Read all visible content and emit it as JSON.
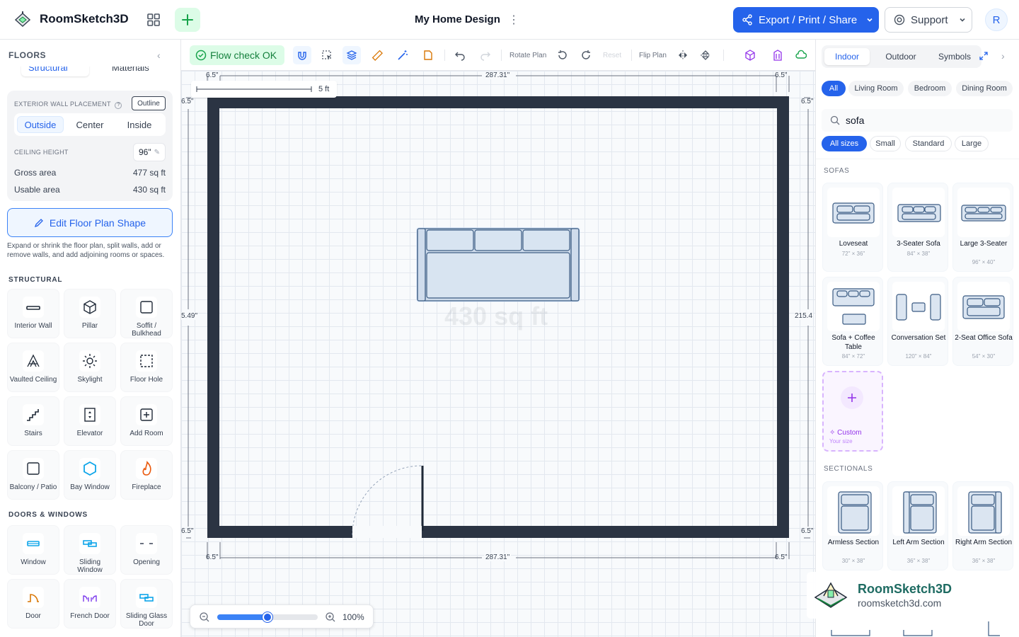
{
  "header": {
    "app_title": "RoomSketch3D",
    "doc_title": "My Home Design",
    "export_label": "Export / Print / Share",
    "support_label": "Support",
    "avatar_initial": "R"
  },
  "left_panel": {
    "title": "FLOORS",
    "mode_tabs": [
      "Structural",
      "Materials"
    ],
    "wall_placement_label": "EXTERIOR WALL PLACEMENT",
    "outline_label": "Outline",
    "placement_options": [
      "Outside",
      "Center",
      "Inside"
    ],
    "ceiling_label": "CEILING HEIGHT",
    "ceiling_value": "96\"",
    "gross_label": "Gross area",
    "gross_value": "477 sq ft",
    "usable_label": "Usable area",
    "usable_value": "430 sq ft",
    "edit_button": "Edit Floor Plan Shape",
    "edit_description": "Expand or shrink the floor plan, split walls, add or remove walls, and add adjoining rooms or spaces.",
    "structural_label": "STRUCTURAL",
    "structural_items": [
      {
        "label": "Interior Wall",
        "icon": "wall-icon"
      },
      {
        "label": "Pillar",
        "icon": "cube-icon"
      },
      {
        "label": "Soffit / Bulkhead",
        "icon": "soffit-icon"
      },
      {
        "label": "Vaulted Ceiling",
        "icon": "vault-icon"
      },
      {
        "label": "Skylight",
        "icon": "sun-icon"
      },
      {
        "label": "Floor Hole",
        "icon": "dashed-square-icon"
      },
      {
        "label": "Stairs",
        "icon": "stairs-icon"
      },
      {
        "label": "Elevator",
        "icon": "elevator-icon"
      },
      {
        "label": "Add Room",
        "icon": "plus-square-icon"
      },
      {
        "label": "Balcony / Patio",
        "icon": "balcony-icon"
      },
      {
        "label": "Bay Window",
        "icon": "hexagon-icon"
      },
      {
        "label": "Fireplace",
        "icon": "flame-icon"
      }
    ],
    "doors_label": "DOORS & WINDOWS",
    "door_items": [
      {
        "label": "Window",
        "icon": "window-icon"
      },
      {
        "label": "Sliding Window",
        "icon": "sliding-window-icon"
      },
      {
        "label": "Opening",
        "icon": "opening-icon"
      },
      {
        "label": "Door",
        "icon": "door-icon"
      },
      {
        "label": "French Door",
        "icon": "french-door-icon"
      },
      {
        "label": "Sliding Glass Door",
        "icon": "sliding-door-icon"
      }
    ]
  },
  "toolbar": {
    "flow_check": "Flow check OK",
    "rotate_label": "Rotate Plan",
    "reset_label": "Reset",
    "flip_label": "Flip Plan"
  },
  "canvas": {
    "dim_top": "287.31\"",
    "dim_bottom": "287.31\"",
    "wall_thickness": "6.5\"",
    "dim_left": "5.49\"",
    "dim_right": "215.4",
    "scale_label": "5 ft",
    "area_label": "430 sq ft",
    "zoom_value": "100%",
    "zoom_level": 0.5
  },
  "right_panel": {
    "tabs": [
      "Indoor",
      "Outdoor",
      "Symbols"
    ],
    "room_chips": [
      "All",
      "Living Room",
      "Bedroom",
      "Dining Room"
    ],
    "search_value": "sofa",
    "size_chips": [
      "All sizes",
      "Small",
      "Standard",
      "Large"
    ],
    "sofas_label": "SOFAS",
    "sofas": [
      {
        "name": "Loveseat",
        "size": "72\" × 36\""
      },
      {
        "name": "3-Seater Sofa",
        "size": "84\" × 38\""
      },
      {
        "name": "Large 3-Seater",
        "size": "96\" × 40\""
      },
      {
        "name": "Sofa + Coffee Table",
        "size": "84\" × 72\""
      },
      {
        "name": "Conversation Set",
        "size": "120\" × 84\""
      },
      {
        "name": "2-Seat Office Sofa",
        "size": "54\" × 30\""
      }
    ],
    "custom_title": "Custom",
    "custom_sub": "Your size",
    "sectionals_label": "SECTIONALS",
    "sectionals": [
      {
        "name": "Armless Section",
        "size": "30\" × 38\""
      },
      {
        "name": "Left Arm Section",
        "size": "36\" × 38\""
      },
      {
        "name": "Right Arm Section",
        "size": "36\" × 38\""
      }
    ]
  },
  "brand": {
    "name": "RoomSketch3D",
    "url": "roomsketch3d.com"
  },
  "colors": {
    "accent": "#2563eb",
    "wall": "#2b3443",
    "flow_ok": "#15803d",
    "custom": "#9333ea"
  }
}
